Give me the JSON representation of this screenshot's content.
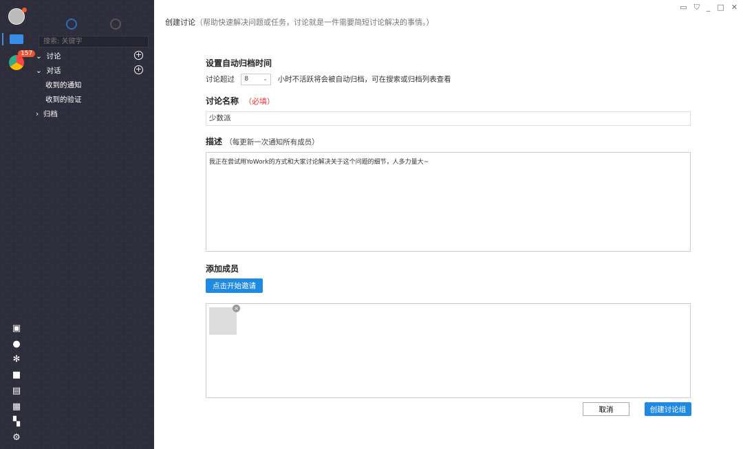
{
  "sidebar": {
    "badge": "157",
    "search_placeholder": "搜索: 关键字",
    "tree": [
      {
        "label": "讨论",
        "expanded": true
      },
      {
        "label": "对话",
        "expanded": true
      },
      {
        "label": "收到的通知"
      },
      {
        "label": "收到的验证"
      },
      {
        "label": "归档",
        "expanded": false
      }
    ]
  },
  "header": {
    "title": "创建讨论",
    "subtitle": "（帮助快速解决问题或任务，讨论就是一件需要简短讨论解决的事情。）"
  },
  "archive": {
    "title": "设置自动归档时间",
    "prefix": "讨论超过",
    "hours": "8",
    "suffix": "小时不活跃将会被自动归档，可在搜索或归档列表查看"
  },
  "name": {
    "label": "讨论名称",
    "required": "（必填）",
    "value": "少数派"
  },
  "desc": {
    "label": "描述",
    "hint": "（每更新一次通知所有成员）",
    "value": "我正在尝试用YoWork的方式和大家讨论解决关于这个问题的细节，人多力量大~"
  },
  "members": {
    "label": "添加成员",
    "invite": "点击开始邀请"
  },
  "actions": {
    "cancel": "取消",
    "create": "创建讨论组"
  }
}
